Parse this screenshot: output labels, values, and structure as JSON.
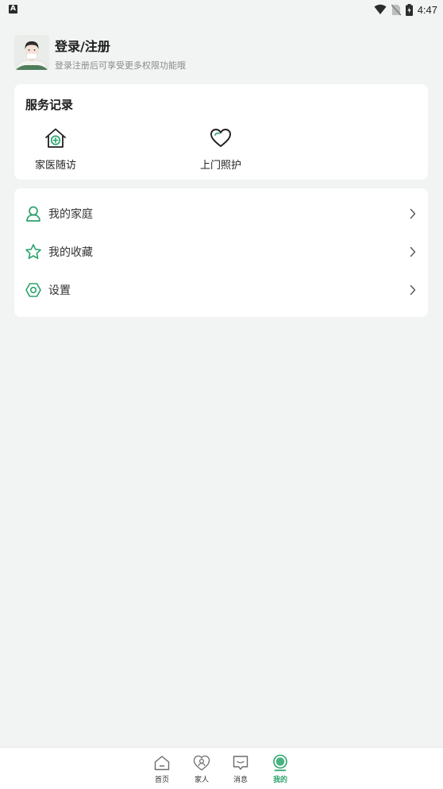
{
  "status_bar": {
    "indicator": "A",
    "time": "4:47"
  },
  "header": {
    "title": "登录/注册",
    "subtitle": "登录注册后可享受更多权限功能哦"
  },
  "service_record": {
    "title": "服务记录",
    "items": [
      {
        "label": "家医随访",
        "icon": "house-plus-icon"
      },
      {
        "label": "上门照护",
        "icon": "heart-icon"
      }
    ]
  },
  "menu": {
    "items": [
      {
        "label": "我的家庭",
        "icon": "user-icon"
      },
      {
        "label": "我的收藏",
        "icon": "star-icon"
      },
      {
        "label": "设置",
        "icon": "settings-icon"
      }
    ]
  },
  "bottom_nav": {
    "tabs": [
      {
        "label": "首页",
        "icon": "home-icon",
        "active": false
      },
      {
        "label": "家人",
        "icon": "family-icon",
        "active": false
      },
      {
        "label": "消息",
        "icon": "message-icon",
        "active": false
      },
      {
        "label": "我的",
        "icon": "profile-icon",
        "active": true
      }
    ]
  },
  "colors": {
    "accent": "#2aa36b",
    "background": "#f2f3f3",
    "card": "#ffffff"
  }
}
